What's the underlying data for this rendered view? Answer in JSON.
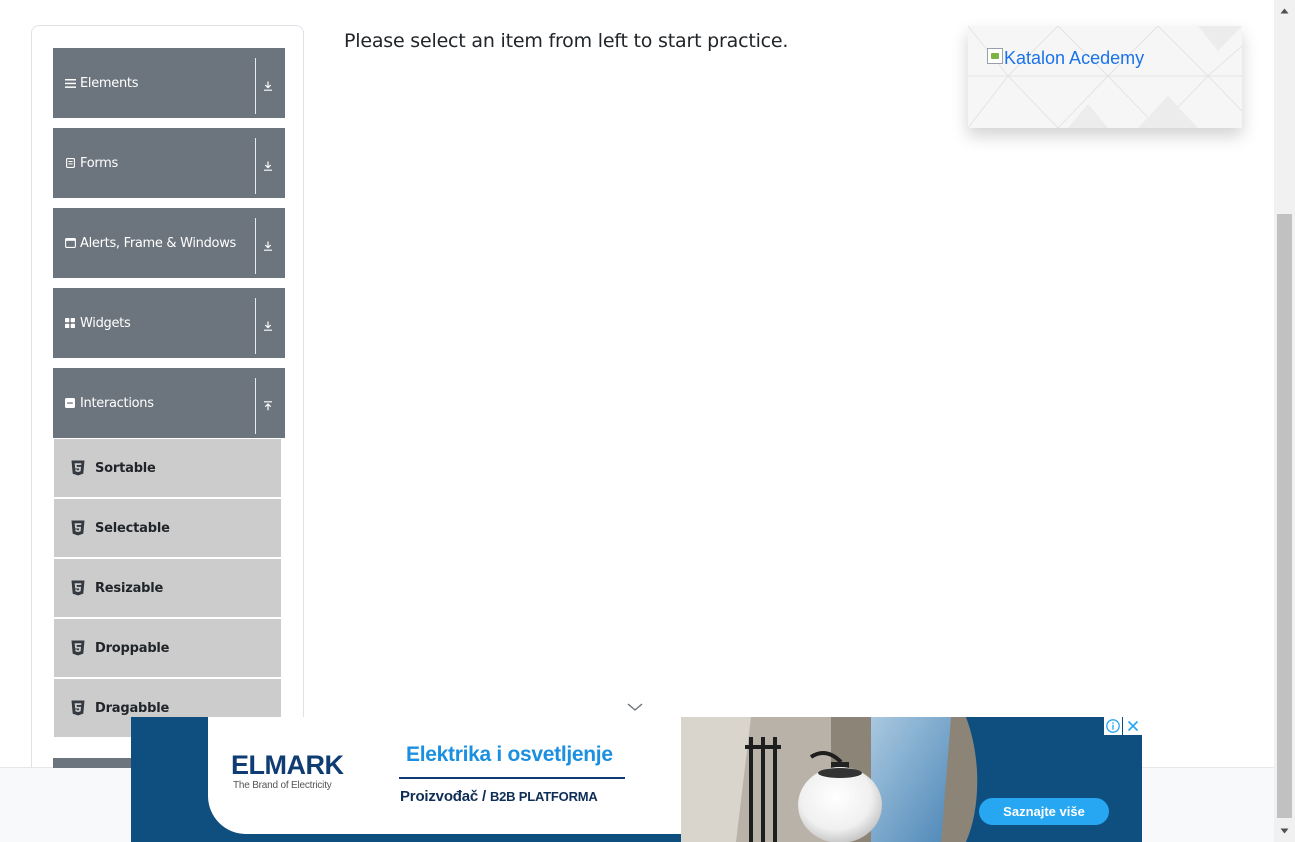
{
  "sidebar": {
    "groups": [
      {
        "label": "Elements",
        "icon": "menu-icon",
        "arrow": "download-arrow-icon"
      },
      {
        "label": "Forms",
        "icon": "form-icon",
        "arrow": "download-arrow-icon"
      },
      {
        "label": "Alerts, Frame & Windows",
        "icon": "window-icon",
        "arrow": "download-arrow-icon"
      },
      {
        "label": "Widgets",
        "icon": "grid-icon",
        "arrow": "download-arrow-icon"
      },
      {
        "label": "Interactions",
        "icon": "collapse-square-icon",
        "arrow": "upload-arrow-icon"
      }
    ],
    "interaction_items": [
      {
        "label": "Sortable",
        "icon": "html5-icon"
      },
      {
        "label": "Selectable",
        "icon": "html5-icon"
      },
      {
        "label": "Resizable",
        "icon": "html5-icon"
      },
      {
        "label": "Droppable",
        "icon": "html5-icon"
      },
      {
        "label": "Dragabble",
        "icon": "html5-icon"
      }
    ]
  },
  "main": {
    "prompt": "Please select an item from left to start practice."
  },
  "banner": {
    "alt_text": "Katalon Acedemy",
    "link_color": "#1a73e8"
  },
  "ad": {
    "brand": "ELMARK",
    "brand_tagline": "The Brand of Electricity",
    "headline": "Elektrika i osvetljenje",
    "subline_main": "Proizvođač / ",
    "subline_small": "B2B PLATFORMA",
    "cta": "Saznajte više",
    "info_icon": "info-icon",
    "close_icon": "close-icon",
    "background_color": "#0f4f80"
  },
  "colors": {
    "group_header_bg": "#6c757d",
    "sub_item_bg": "#cccccc",
    "text": "#212529"
  }
}
